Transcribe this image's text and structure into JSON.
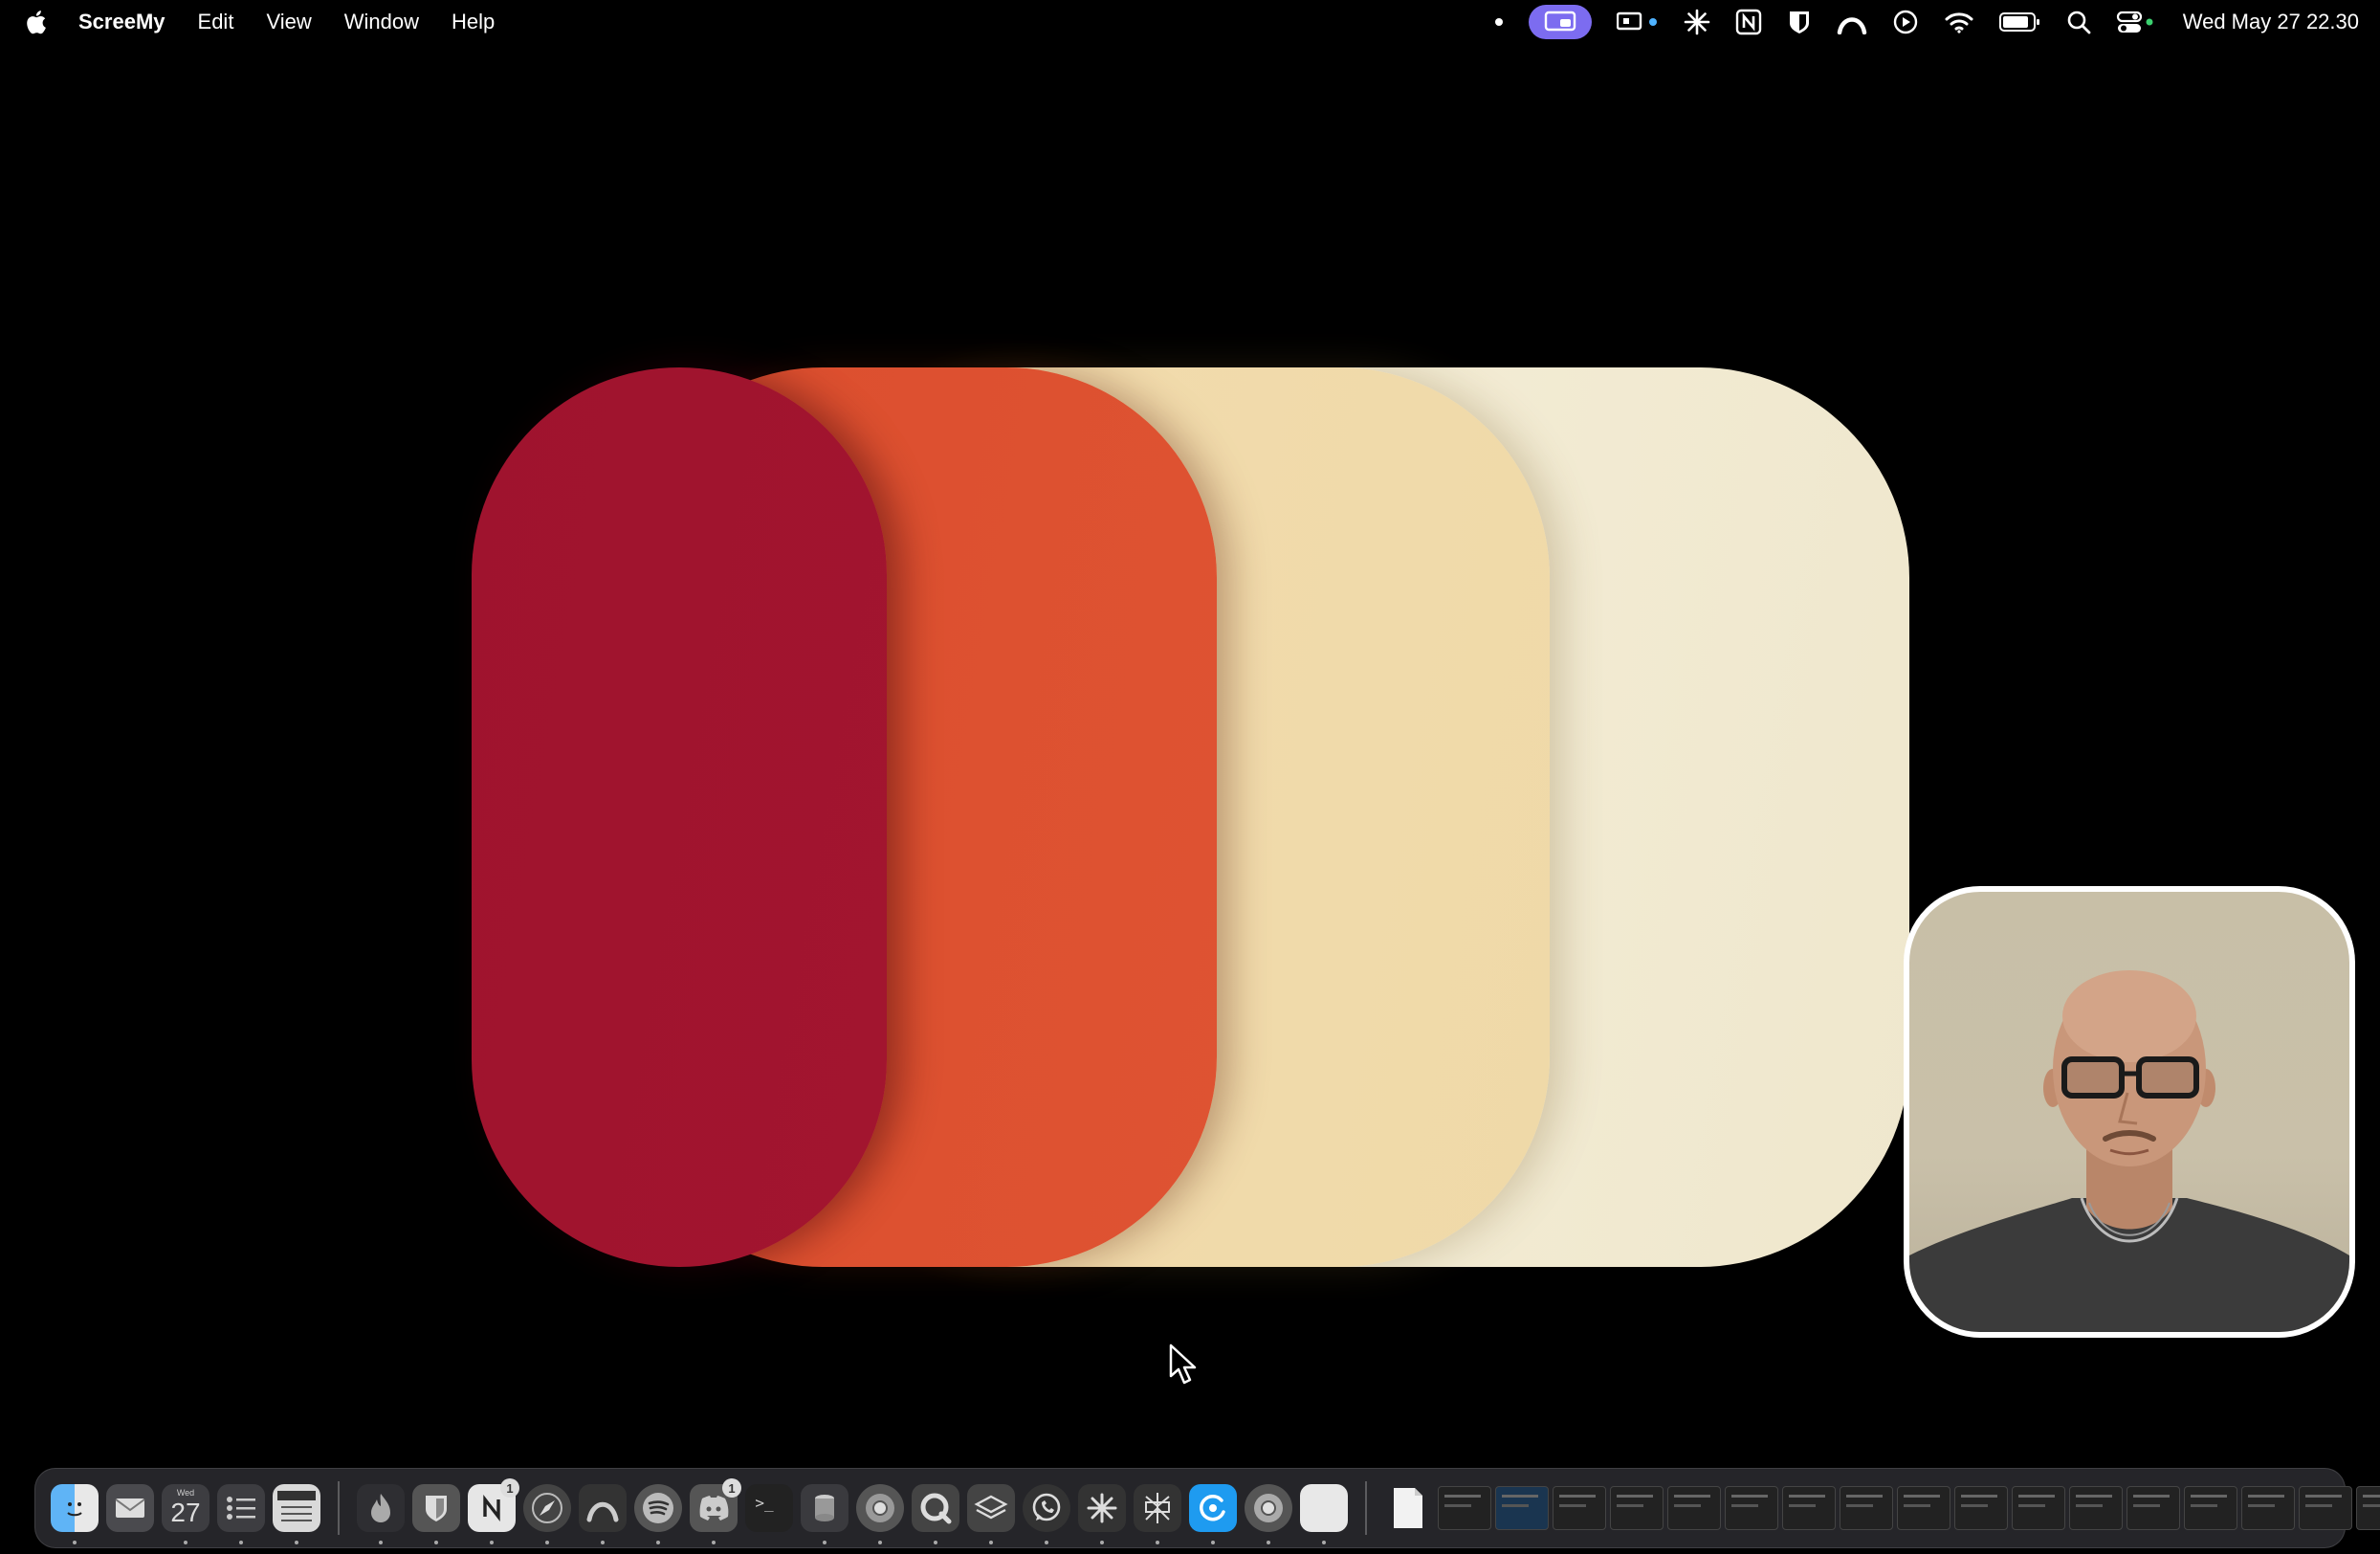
{
  "menubar": {
    "app_name": "ScreeMy",
    "menus": [
      "Edit",
      "View",
      "Window",
      "Help"
    ],
    "clock": "Wed May 27  22.30",
    "status_icons": [
      "dot-icon",
      "screen-record-icon",
      "display-icon",
      "sparkle-icon",
      "notion-icon",
      "bitwarden-icon",
      "arc-icon",
      "play-icon",
      "wifi-icon",
      "battery-icon",
      "search-icon",
      "control-center-icon"
    ],
    "record_color": "#7c6cf0"
  },
  "slide": {
    "colors": [
      "#a2152f",
      "#de5332",
      "#f2dbab",
      "#f3ecd5"
    ]
  },
  "dock": {
    "calendar_month": "Wed",
    "calendar_day": "27",
    "badges": {
      "notion": "1",
      "discord": "1"
    },
    "terminal_prompt": ">_"
  }
}
